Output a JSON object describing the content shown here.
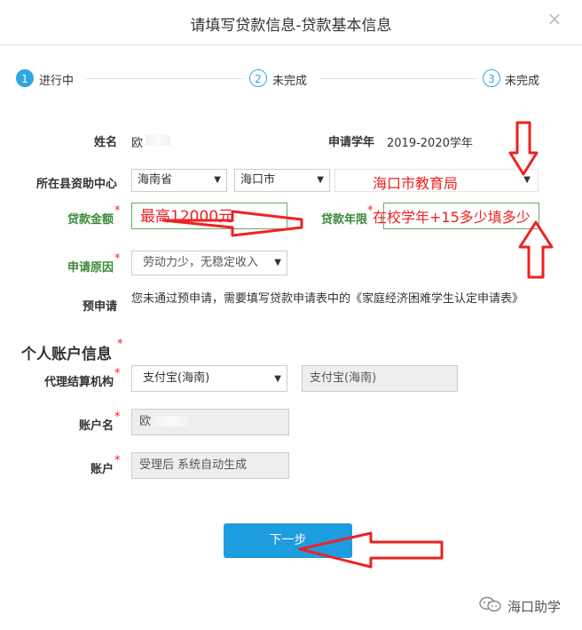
{
  "dialog": {
    "title": "请填写贷款信息-贷款基本信息",
    "close_label": "×"
  },
  "steps": [
    {
      "num": "1",
      "label": "进行中"
    },
    {
      "num": "2",
      "label": "未完成"
    },
    {
      "num": "3",
      "label": "未完成"
    }
  ],
  "form": {
    "name_label": "姓名",
    "name_value": "欧",
    "year_label": "申请学年",
    "year_value": "2019-2020学年",
    "center_label": "所在县资助中心",
    "province": "海南省",
    "city": "海口市",
    "bureau": "海口市教育局",
    "amount_label": "贷款金额",
    "amount_value": "最高12000元",
    "term_label": "贷款年限",
    "term_value": "在校学年+15多少填多少",
    "reason_label": "申请原因",
    "reason_value": "劳动力少，无稳定收入",
    "preapply_label": "预申请",
    "preapply_text": "您未通过预申请，需要填写贷款申请表中的《家庭经济困难学生认定申请表》"
  },
  "account": {
    "section_title": "个人账户信息",
    "agency_label": "代理结算机构",
    "agency_select": "支付宝(海南)",
    "agency_display": "支付宝(海南)",
    "account_name_label": "账户名",
    "account_name_value": "欧",
    "account_label": "账户",
    "account_value": "受理后 系统自动生成"
  },
  "next_button": "下一步",
  "watermark": "海口助学",
  "required_mark": "*",
  "colors": {
    "accent": "#1e9ce0",
    "annotation": "#e22222",
    "label_green": "#3a8a3a"
  }
}
